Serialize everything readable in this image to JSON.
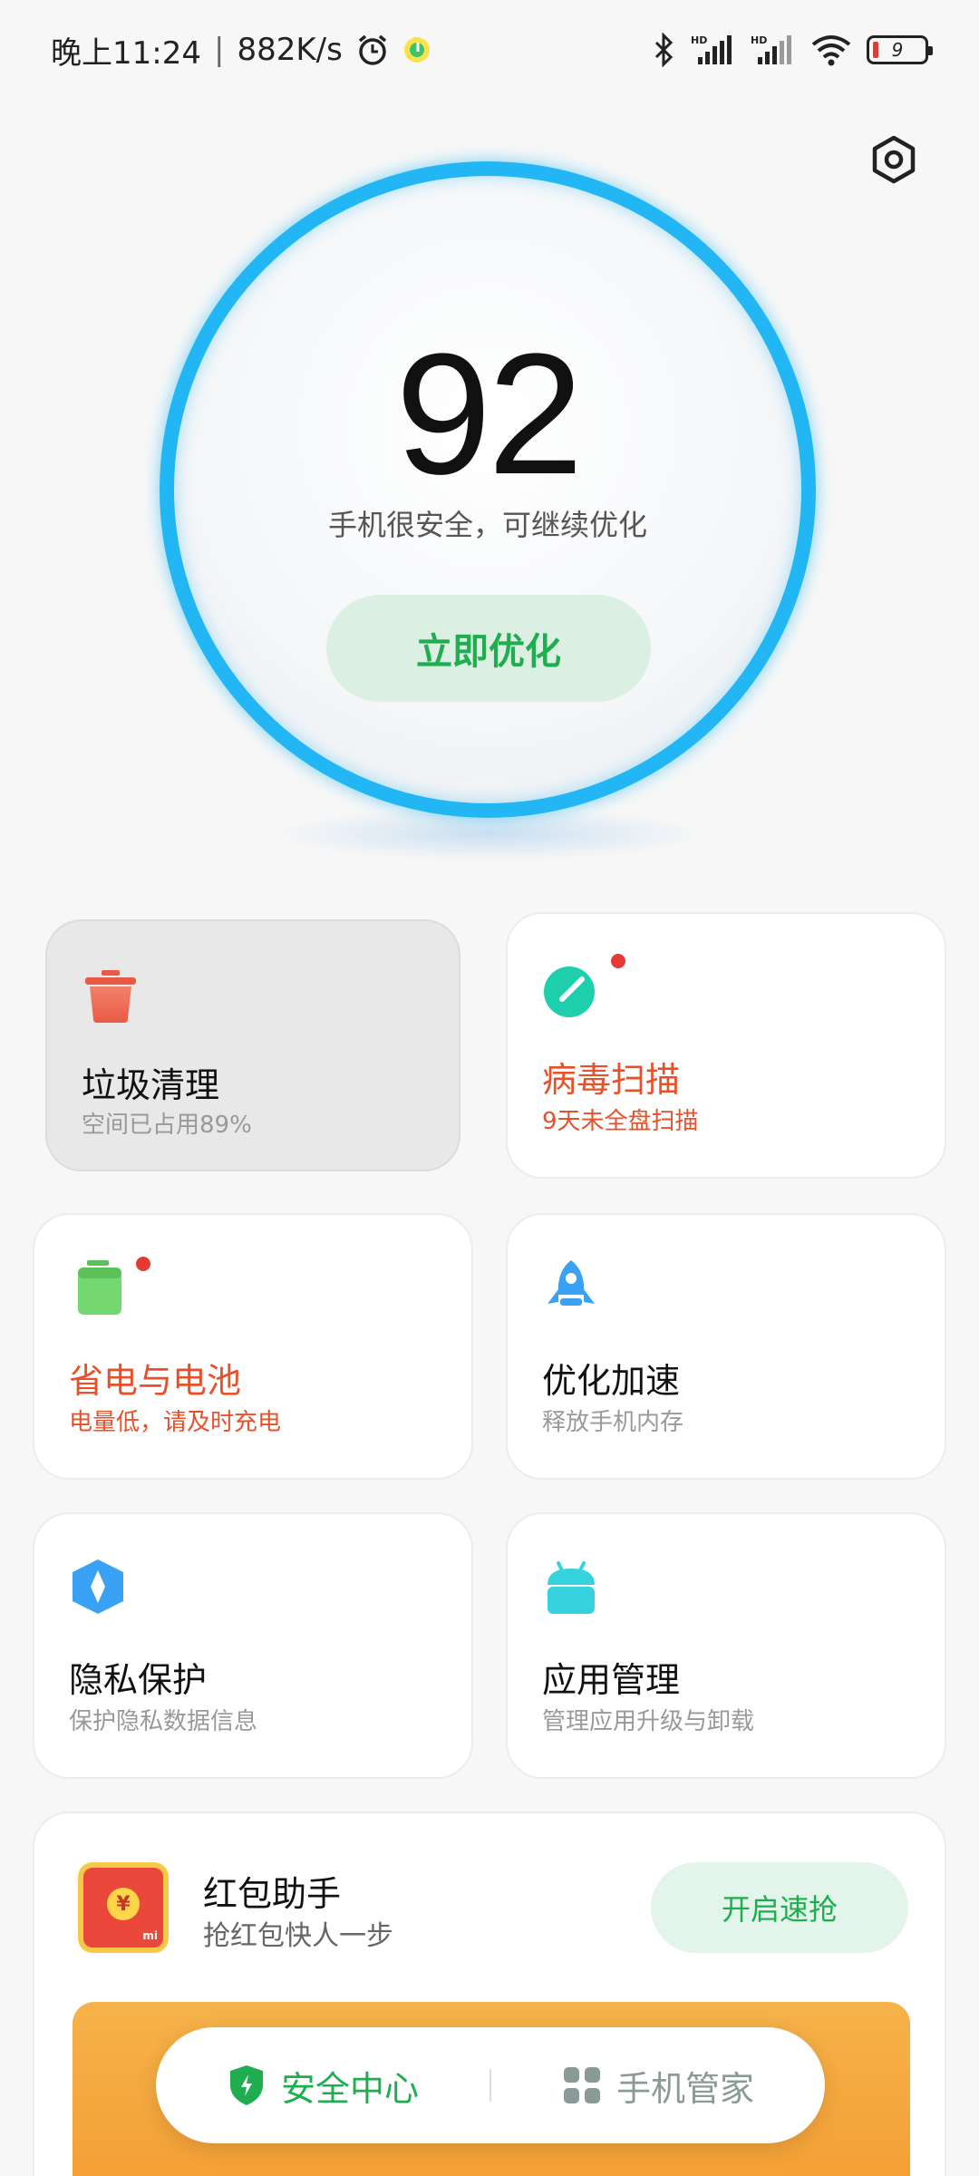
{
  "status_bar": {
    "time": "晚上11:24",
    "separator": "|",
    "speed": "882K/s",
    "battery_level": "9"
  },
  "score": {
    "value": "92",
    "message": "手机很安全，可继续优化",
    "button_label": "立即优化"
  },
  "cards": [
    {
      "title": "垃圾清理",
      "subtitle": "空间已占用89%",
      "icon": "trash-icon",
      "color": "#ee6a52"
    },
    {
      "title": "病毒扫描",
      "subtitle": "9天未全盘扫描",
      "icon": "scan-icon",
      "color": "#1ecfae"
    },
    {
      "title": "省电与电池",
      "subtitle": "电量低，请及时充电",
      "icon": "battery-icon",
      "color": "#6ed36b"
    },
    {
      "title": "优化加速",
      "subtitle": "释放手机内存",
      "icon": "rocket-icon",
      "color": "#3aa2f5"
    },
    {
      "title": "隐私保护",
      "subtitle": "保护隐私数据信息",
      "icon": "privacy-icon",
      "color": "#3aa2f5"
    },
    {
      "title": "应用管理",
      "subtitle": "管理应用升级与卸载",
      "icon": "android-icon",
      "color": "#36d3de"
    }
  ],
  "red_packet": {
    "title": "红包助手",
    "subtitle": "抢红包快人一步",
    "button_label": "开启速抢",
    "icon_coin": "¥",
    "icon_brand": "mi"
  },
  "tabs": [
    {
      "label": "安全中心",
      "icon": "shield-icon",
      "active": true
    },
    {
      "label": "手机管家",
      "icon": "grid-icon",
      "active": false
    }
  ],
  "colors": {
    "accent_green": "#1fae4f",
    "ring_blue": "#22b6f4",
    "warning": "#e8502a"
  }
}
